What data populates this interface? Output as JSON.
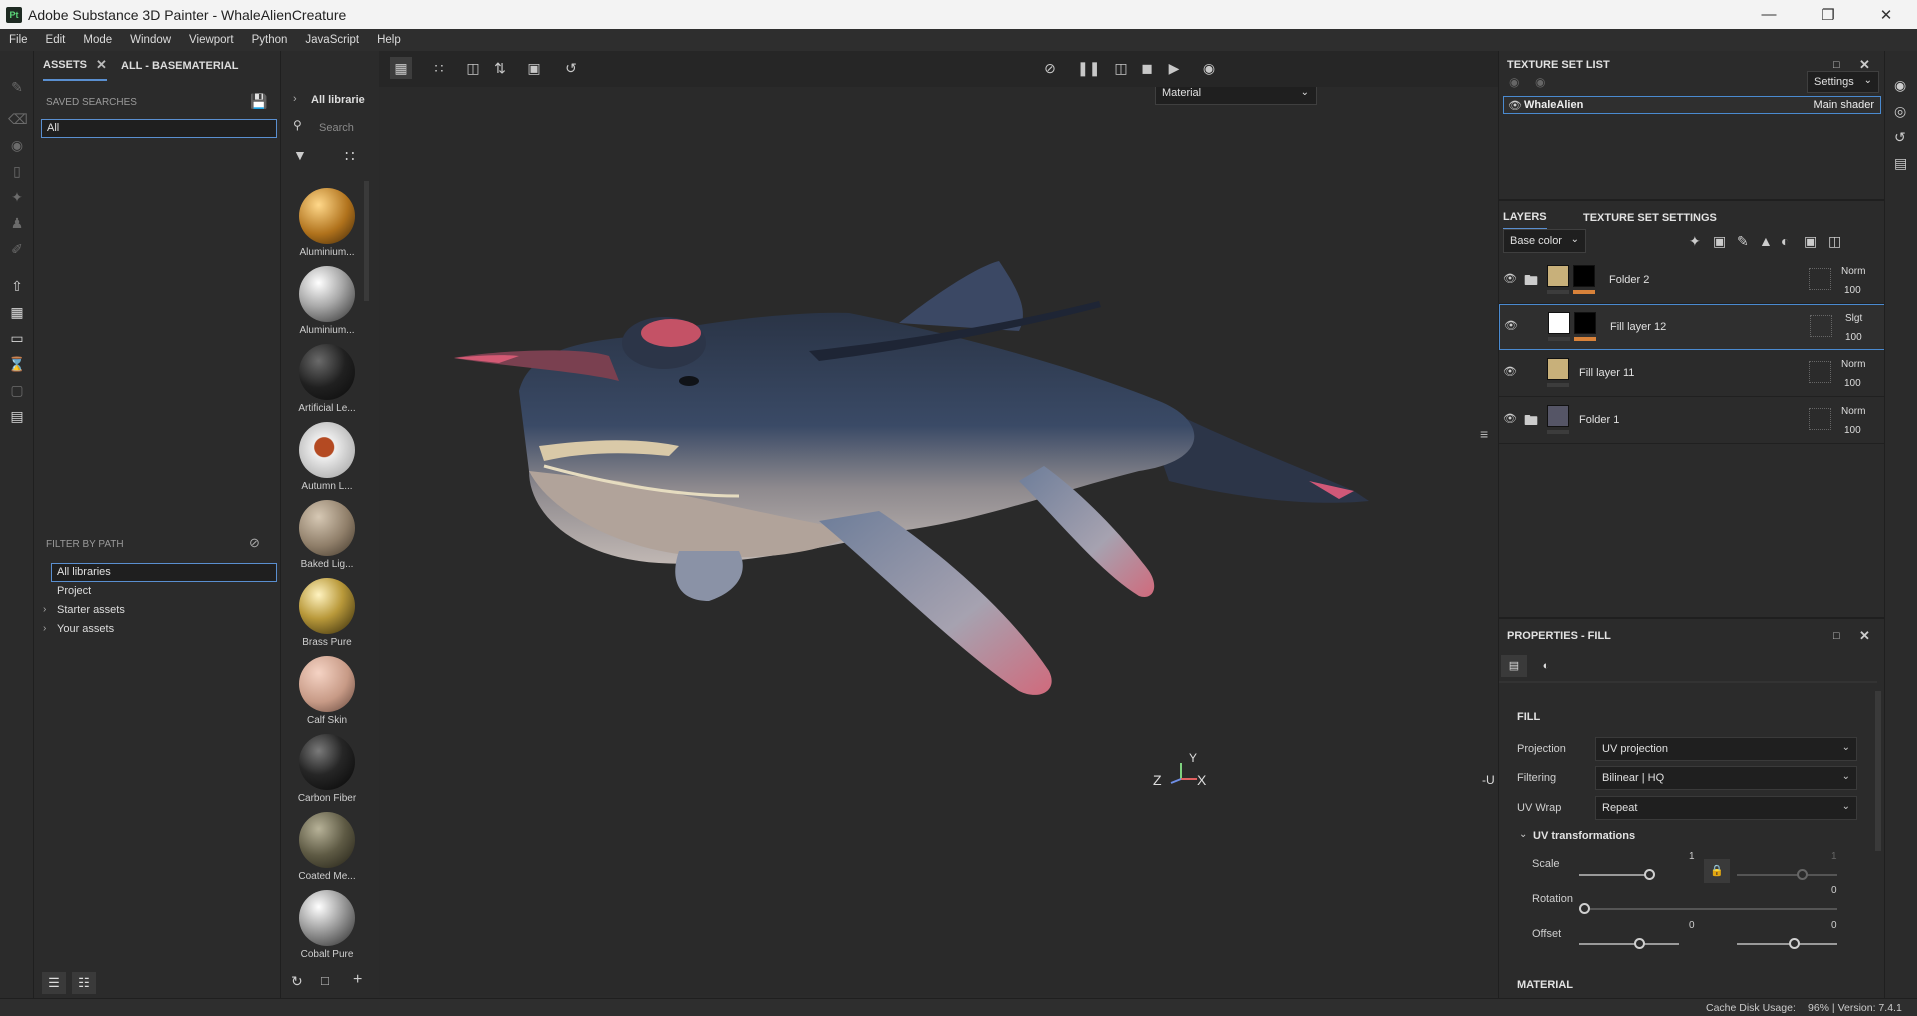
{
  "window": {
    "title": "Adobe Substance 3D Painter - WhaleAlienCreature",
    "app_icon_text": "Pt"
  },
  "menu": [
    "File",
    "Edit",
    "Mode",
    "Window",
    "Viewport",
    "Python",
    "JavaScript",
    "Help"
  ],
  "assets": {
    "tab_assets": "ASSETS",
    "tab_all": "ALL - BASEMATERIAL",
    "saved_searches_label": "SAVED SEARCHES",
    "search_value": "All",
    "filter_by_path_label": "FILTER BY PATH",
    "paths": [
      "All libraries",
      "Project",
      "Starter assets",
      "Your assets"
    ]
  },
  "library": {
    "breadcrumb": "All librarie",
    "search_placeholder": "Search",
    "materials": [
      "Aluminium...",
      "Aluminium...",
      "Artificial Le...",
      "Autumn L...",
      "Baked Lig...",
      "Brass Pure",
      "Calf Skin",
      "Carbon Fiber",
      "Coated Me...",
      "Cobalt Pure"
    ]
  },
  "viewport": {
    "channel_select": "Material",
    "axis_y": "Y",
    "axis_z": "Z",
    "axis_x": "X",
    "axis_u": "-U"
  },
  "texture_set_list": {
    "title": "TEXTURE SET LIST",
    "settings_label": "Settings",
    "item_name": "WhaleAlien",
    "item_shader": "Main shader"
  },
  "layers": {
    "tab_layers": "LAYERS",
    "tab_tss": "TEXTURE SET SETTINGS",
    "channel": "Base color",
    "items": [
      {
        "name": "Folder 2",
        "blend": "Norm",
        "opacity": "100"
      },
      {
        "name": "Fill layer 12",
        "blend": "Slgt",
        "opacity": "100"
      },
      {
        "name": "Fill layer 11",
        "blend": "Norm",
        "opacity": "100"
      },
      {
        "name": "Folder 1",
        "blend": "Norm",
        "opacity": "100"
      }
    ]
  },
  "properties": {
    "title": "PROPERTIES - FILL",
    "fill_label": "FILL",
    "projection_label": "Projection",
    "projection_value": "UV projection",
    "filtering_label": "Filtering",
    "filtering_value": "Bilinear | HQ",
    "uvwrap_label": "UV Wrap",
    "uvwrap_value": "Repeat",
    "uv_transformations_label": "UV transformations",
    "scale_label": "Scale",
    "scale_value_1": "1",
    "scale_value_2": "1",
    "rotation_label": "Rotation",
    "rotation_value": "0",
    "offset_label": "Offset",
    "offset_value_1": "0",
    "offset_value_2": "0",
    "material_label": "MATERIAL"
  },
  "status": {
    "cache": "Cache Disk Usage:",
    "version": "96% | Version: 7.4.1"
  }
}
